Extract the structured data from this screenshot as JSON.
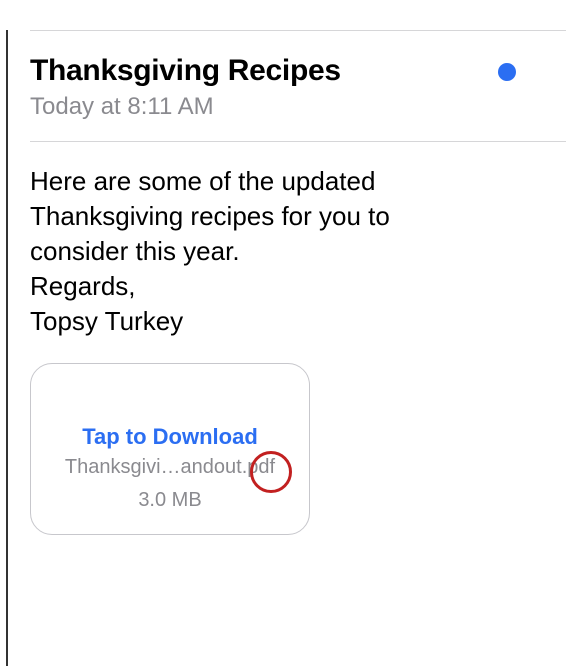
{
  "email": {
    "subject": "Thanksgiving Recipes",
    "timestamp": "Today at 8:11 AM",
    "body_line1": "Here are some of the updated",
    "body_line2": "Thanksgiving recipes for you to",
    "body_line3": "consider this year.",
    "body_line4": "Regards,",
    "body_line5": "Topsy Turkey"
  },
  "attachment": {
    "action_label": "Tap to Download",
    "filename": "Thanksgivi…andout.pdf",
    "filesize": "3.0 MB"
  }
}
